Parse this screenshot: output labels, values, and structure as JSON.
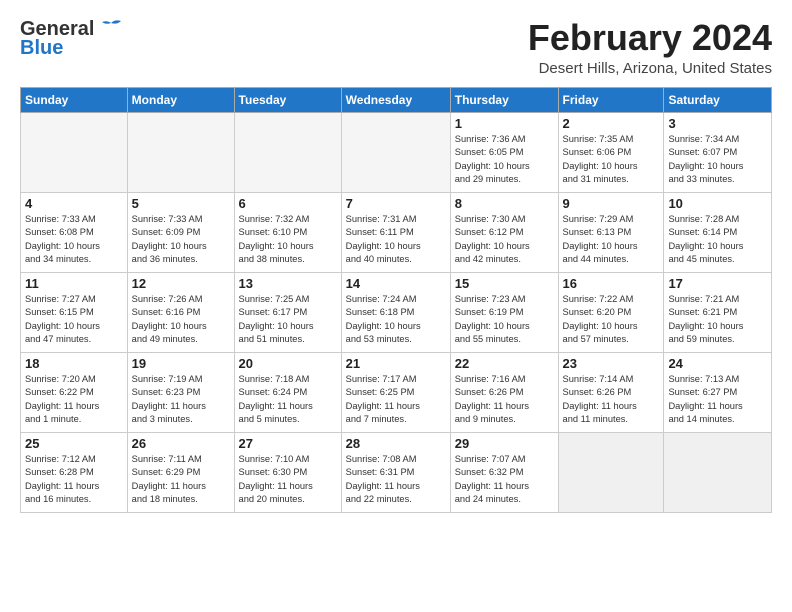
{
  "header": {
    "logo_general": "General",
    "logo_blue": "Blue",
    "month": "February 2024",
    "location": "Desert Hills, Arizona, United States"
  },
  "weekdays": [
    "Sunday",
    "Monday",
    "Tuesday",
    "Wednesday",
    "Thursday",
    "Friday",
    "Saturday"
  ],
  "weeks": [
    [
      {
        "day": "",
        "info": ""
      },
      {
        "day": "",
        "info": ""
      },
      {
        "day": "",
        "info": ""
      },
      {
        "day": "",
        "info": ""
      },
      {
        "day": "1",
        "info": "Sunrise: 7:36 AM\nSunset: 6:05 PM\nDaylight: 10 hours\nand 29 minutes."
      },
      {
        "day": "2",
        "info": "Sunrise: 7:35 AM\nSunset: 6:06 PM\nDaylight: 10 hours\nand 31 minutes."
      },
      {
        "day": "3",
        "info": "Sunrise: 7:34 AM\nSunset: 6:07 PM\nDaylight: 10 hours\nand 33 minutes."
      }
    ],
    [
      {
        "day": "4",
        "info": "Sunrise: 7:33 AM\nSunset: 6:08 PM\nDaylight: 10 hours\nand 34 minutes."
      },
      {
        "day": "5",
        "info": "Sunrise: 7:33 AM\nSunset: 6:09 PM\nDaylight: 10 hours\nand 36 minutes."
      },
      {
        "day": "6",
        "info": "Sunrise: 7:32 AM\nSunset: 6:10 PM\nDaylight: 10 hours\nand 38 minutes."
      },
      {
        "day": "7",
        "info": "Sunrise: 7:31 AM\nSunset: 6:11 PM\nDaylight: 10 hours\nand 40 minutes."
      },
      {
        "day": "8",
        "info": "Sunrise: 7:30 AM\nSunset: 6:12 PM\nDaylight: 10 hours\nand 42 minutes."
      },
      {
        "day": "9",
        "info": "Sunrise: 7:29 AM\nSunset: 6:13 PM\nDaylight: 10 hours\nand 44 minutes."
      },
      {
        "day": "10",
        "info": "Sunrise: 7:28 AM\nSunset: 6:14 PM\nDaylight: 10 hours\nand 45 minutes."
      }
    ],
    [
      {
        "day": "11",
        "info": "Sunrise: 7:27 AM\nSunset: 6:15 PM\nDaylight: 10 hours\nand 47 minutes."
      },
      {
        "day": "12",
        "info": "Sunrise: 7:26 AM\nSunset: 6:16 PM\nDaylight: 10 hours\nand 49 minutes."
      },
      {
        "day": "13",
        "info": "Sunrise: 7:25 AM\nSunset: 6:17 PM\nDaylight: 10 hours\nand 51 minutes."
      },
      {
        "day": "14",
        "info": "Sunrise: 7:24 AM\nSunset: 6:18 PM\nDaylight: 10 hours\nand 53 minutes."
      },
      {
        "day": "15",
        "info": "Sunrise: 7:23 AM\nSunset: 6:19 PM\nDaylight: 10 hours\nand 55 minutes."
      },
      {
        "day": "16",
        "info": "Sunrise: 7:22 AM\nSunset: 6:20 PM\nDaylight: 10 hours\nand 57 minutes."
      },
      {
        "day": "17",
        "info": "Sunrise: 7:21 AM\nSunset: 6:21 PM\nDaylight: 10 hours\nand 59 minutes."
      }
    ],
    [
      {
        "day": "18",
        "info": "Sunrise: 7:20 AM\nSunset: 6:22 PM\nDaylight: 11 hours\nand 1 minute."
      },
      {
        "day": "19",
        "info": "Sunrise: 7:19 AM\nSunset: 6:23 PM\nDaylight: 11 hours\nand 3 minutes."
      },
      {
        "day": "20",
        "info": "Sunrise: 7:18 AM\nSunset: 6:24 PM\nDaylight: 11 hours\nand 5 minutes."
      },
      {
        "day": "21",
        "info": "Sunrise: 7:17 AM\nSunset: 6:25 PM\nDaylight: 11 hours\nand 7 minutes."
      },
      {
        "day": "22",
        "info": "Sunrise: 7:16 AM\nSunset: 6:26 PM\nDaylight: 11 hours\nand 9 minutes."
      },
      {
        "day": "23",
        "info": "Sunrise: 7:14 AM\nSunset: 6:26 PM\nDaylight: 11 hours\nand 11 minutes."
      },
      {
        "day": "24",
        "info": "Sunrise: 7:13 AM\nSunset: 6:27 PM\nDaylight: 11 hours\nand 14 minutes."
      }
    ],
    [
      {
        "day": "25",
        "info": "Sunrise: 7:12 AM\nSunset: 6:28 PM\nDaylight: 11 hours\nand 16 minutes."
      },
      {
        "day": "26",
        "info": "Sunrise: 7:11 AM\nSunset: 6:29 PM\nDaylight: 11 hours\nand 18 minutes."
      },
      {
        "day": "27",
        "info": "Sunrise: 7:10 AM\nSunset: 6:30 PM\nDaylight: 11 hours\nand 20 minutes."
      },
      {
        "day": "28",
        "info": "Sunrise: 7:08 AM\nSunset: 6:31 PM\nDaylight: 11 hours\nand 22 minutes."
      },
      {
        "day": "29",
        "info": "Sunrise: 7:07 AM\nSunset: 6:32 PM\nDaylight: 11 hours\nand 24 minutes."
      },
      {
        "day": "",
        "info": ""
      },
      {
        "day": "",
        "info": ""
      }
    ]
  ]
}
